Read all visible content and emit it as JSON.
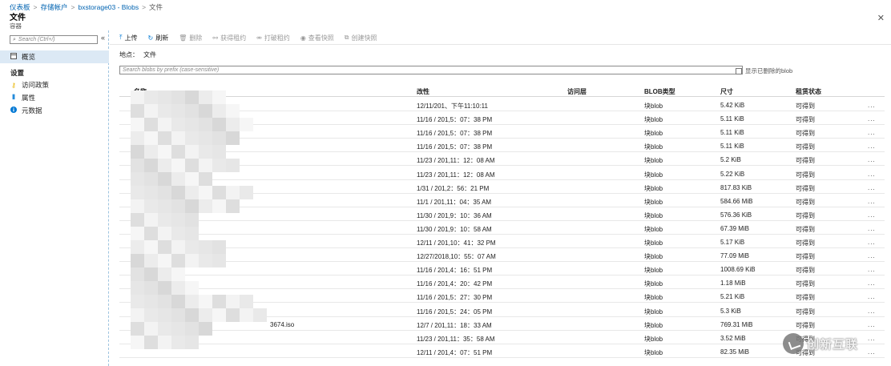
{
  "breadcrumb": {
    "items": [
      "仪表板",
      "存储帐户",
      "bxstorage03 - Blobs",
      "文件"
    ],
    "separator": ">"
  },
  "blade": {
    "title": "文件",
    "subtitle": "容器",
    "close_icon": "close-icon"
  },
  "sidebar": {
    "search_placeholder": "Search (Ctrl+/)",
    "collapse_glyph": "«",
    "overview_label": "概览",
    "settings_title": "设置",
    "items": [
      {
        "label": "访问政策",
        "icon": "key-icon"
      },
      {
        "label": "属性",
        "icon": "properties-icon"
      },
      {
        "label": "元数据",
        "icon": "info-icon"
      }
    ]
  },
  "toolbar": {
    "upload": "上传",
    "refresh": "刷新",
    "delete": "删除",
    "acquire_lease": "获得租约",
    "break_lease": "打破租约",
    "view_snapshots": "查看快照",
    "create_snapshot": "创建快照"
  },
  "location": {
    "label": "地点：",
    "value": "文件"
  },
  "blob_search": {
    "placeholder": "Search blobs by prefix (case-sensitive)"
  },
  "show_deleted": {
    "label": "显示已删除的blob",
    "checked": false
  },
  "table": {
    "headers": {
      "name": "名称",
      "modified": "改性",
      "access_tier": "访问层",
      "blob_type": "BLOB类型",
      "size": "尺寸",
      "lease_state": "租赁状态"
    },
    "rows": [
      {
        "name": "",
        "modified": "12/11/201、下午11:10:11",
        "access": "",
        "type": "块blob",
        "size": "5.42 KiB",
        "lease": "可得到"
      },
      {
        "name": "",
        "modified": "11/16 / 201,5：07：38 PM",
        "access": "",
        "type": "块blob",
        "size": "5.11 KiB",
        "lease": "可得到"
      },
      {
        "name": "",
        "modified": "11/16 / 201,5：07：38 PM",
        "access": "",
        "type": "块blob",
        "size": "5.11 KiB",
        "lease": "可得到"
      },
      {
        "name": "",
        "modified": "11/16 / 201,5：07：38 PM",
        "access": "",
        "type": "块blob",
        "size": "5.11 KiB",
        "lease": "可得到"
      },
      {
        "name": "",
        "modified": "11/23 / 201,11：12：08 AM",
        "access": "",
        "type": "块blob",
        "size": "5.2 KiB",
        "lease": "可得到"
      },
      {
        "name": "",
        "modified": "11/23 / 201,11：12：08 AM",
        "access": "",
        "type": "块blob",
        "size": "5.22 KiB",
        "lease": "可得到"
      },
      {
        "name": "",
        "modified": "1/31 / 201,2：56：21 PM",
        "access": "",
        "type": "块blob",
        "size": "817.83 KiB",
        "lease": "可得到"
      },
      {
        "name": "",
        "modified": "11/1 / 201,11：04：35 AM",
        "access": "",
        "type": "块blob",
        "size": "584.66 MiB",
        "lease": "可得到"
      },
      {
        "name": "",
        "modified": "11/30 / 201,9：10：36 AM",
        "access": "",
        "type": "块blob",
        "size": "576.36 KiB",
        "lease": "可得到"
      },
      {
        "name": "",
        "modified": "11/30 / 201,9：10：58 AM",
        "access": "",
        "type": "块blob",
        "size": "67.39 MiB",
        "lease": "可得到"
      },
      {
        "name": "",
        "modified": "12/11 / 201,10：41：32 PM",
        "access": "",
        "type": "块blob",
        "size": "5.17 KiB",
        "lease": "可得到"
      },
      {
        "name": "",
        "modified": "12/27/2018,10：55：07 AM",
        "access": "",
        "type": "块blob",
        "size": "77.09 MiB",
        "lease": "可得到"
      },
      {
        "name": "",
        "modified": "11/16 / 201,4：16：51 PM",
        "access": "",
        "type": "块blob",
        "size": "1008.69 KiB",
        "lease": "可得到"
      },
      {
        "name": "",
        "modified": "11/16 / 201,4：20：42 PM",
        "access": "",
        "type": "块blob",
        "size": "1.18 MiB",
        "lease": "可得到"
      },
      {
        "name": "",
        "modified": "11/16 / 201,5：27：30 PM",
        "access": "",
        "type": "块blob",
        "size": "5.21 KiB",
        "lease": "可得到"
      },
      {
        "name": "",
        "modified": "11/16 / 201,5：24：05 PM",
        "access": "",
        "type": "块blob",
        "size": "5.3 KiB",
        "lease": "可得到"
      },
      {
        "name": "3674.iso",
        "modified": "12/7 / 201,11：18：33 AM",
        "access": "",
        "type": "块blob",
        "size": "769.31 MiB",
        "lease": "可得到"
      },
      {
        "name": "",
        "modified": "11/23 / 201,11：35：58 AM",
        "access": "",
        "type": "块blob",
        "size": "3.52 MiB",
        "lease": "可得到"
      },
      {
        "name": "",
        "modified": "12/11 / 201,4：07：51 PM",
        "access": "",
        "type": "块blob",
        "size": "82.35 MiB",
        "lease": "可得到"
      }
    ],
    "row_menu_glyph": "..."
  },
  "watermark": {
    "text": "创新互联"
  },
  "colors": {
    "link": "#0063b1",
    "accent": "#0078d4",
    "selected_nav": "#dce9f5",
    "divider_dashed": "#9ec4e0"
  }
}
